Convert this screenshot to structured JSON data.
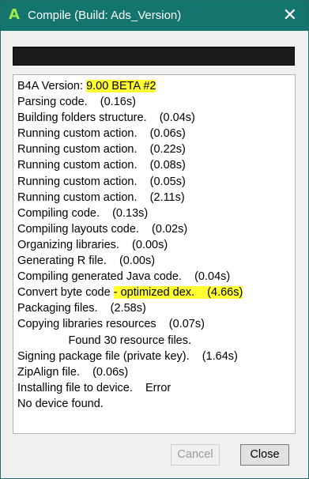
{
  "window": {
    "title": "Compile (Build: Ads_Version)",
    "icon_letter": "A",
    "close_glyph": "✕"
  },
  "progress": {
    "value_fraction": 1.0
  },
  "log": {
    "lines": [
      [
        "B4A Version: ",
        "9.00 BETA #2"
      ],
      [
        "Parsing code.    (0.16s)"
      ],
      [
        "Building folders structure.    (0.04s)"
      ],
      [
        "Running custom action.    (0.06s)"
      ],
      [
        "Running custom action.    (0.22s)"
      ],
      [
        "Running custom action.    (0.08s)"
      ],
      [
        "Running custom action.    (0.05s)"
      ],
      [
        "Running custom action.    (2.11s)"
      ],
      [
        "Compiling code.    (0.13s)"
      ],
      [
        "Compiling layouts code.    (0.02s)"
      ],
      [
        "Organizing libraries.    (0.00s)"
      ],
      [
        "Generating R file.    (0.00s)"
      ],
      [
        "Compiling generated Java code.    (0.04s)"
      ],
      [
        "Convert byte code ",
        "- optimized dex.    (4.66s)"
      ],
      [
        "Packaging files.    (2.58s)"
      ],
      [
        "Copying libraries resources    (0.07s)"
      ],
      [
        "                Found 30 resource files."
      ],
      [
        "Signing package file (private key).    (1.64s)"
      ],
      [
        "ZipAlign file.    (0.06s)"
      ],
      [
        "Installing file to device.    Error"
      ],
      [
        "No device found."
      ]
    ]
  },
  "buttons": {
    "cancel": "Cancel",
    "close": "Close"
  },
  "colors": {
    "titlebar": "#14756f",
    "highlight": "#ffff33"
  }
}
